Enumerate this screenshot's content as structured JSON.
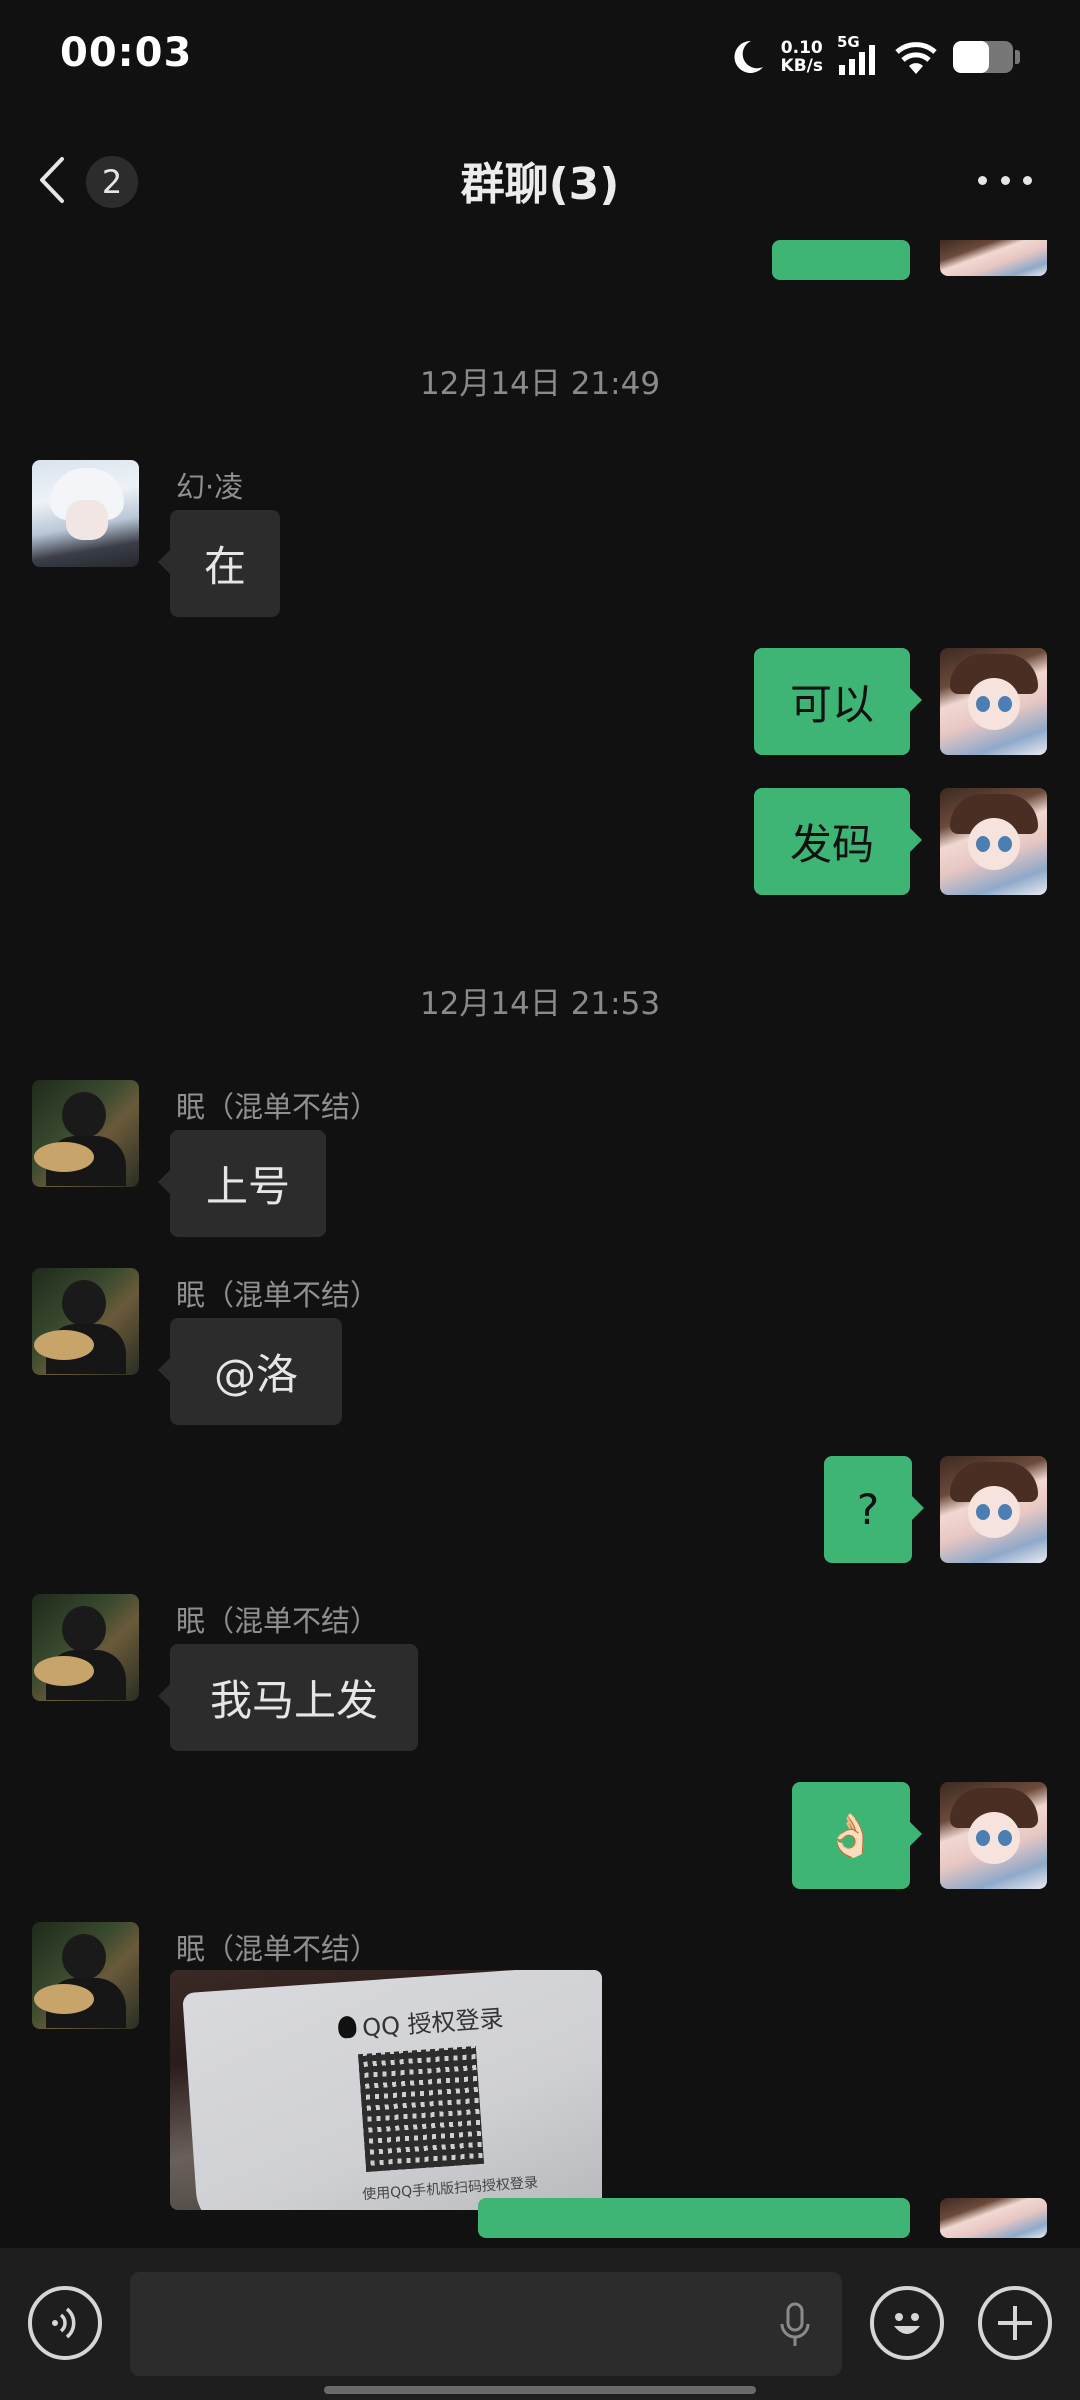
{
  "status_bar": {
    "time": "00:03",
    "net_speed_value": "0.10",
    "net_speed_unit": "KB/s",
    "network_type": "5G",
    "battery_level_percent": 60
  },
  "nav": {
    "back_badge": "2",
    "title": "群聊(3)"
  },
  "messages": {
    "timestamp_1": "12月14日 21:49",
    "timestamp_2": "12月14日 21:53",
    "sender_huanling": "幻·凌",
    "msg_1": "在",
    "msg_2": "可以",
    "msg_3": "发码",
    "sender_mian_1": "眠（混单不结）",
    "msg_4": "上号",
    "sender_mian_2": "眠（混单不结）",
    "msg_5": "@洛",
    "msg_6": "?",
    "sender_mian_3": "眠（混单不结）",
    "msg_7": "我马上发",
    "msg_8": "👌🏻",
    "sender_mian_4": "眠（混单不结）",
    "image_msg": {
      "title": "QQ 授权登录",
      "caption": "使用QQ手机版扫码授权登录"
    }
  },
  "input_bar": {
    "voice_icon": "voice-toggle-icon",
    "mic_icon": "microphone-icon",
    "emoji_icon": "emoji-icon",
    "plus_icon": "plus-icon"
  },
  "colors": {
    "background": "#111111",
    "incoming_bubble": "#2c2c2c",
    "outgoing_bubble": "#3eb575",
    "secondary_text": "#8f8f8f"
  }
}
